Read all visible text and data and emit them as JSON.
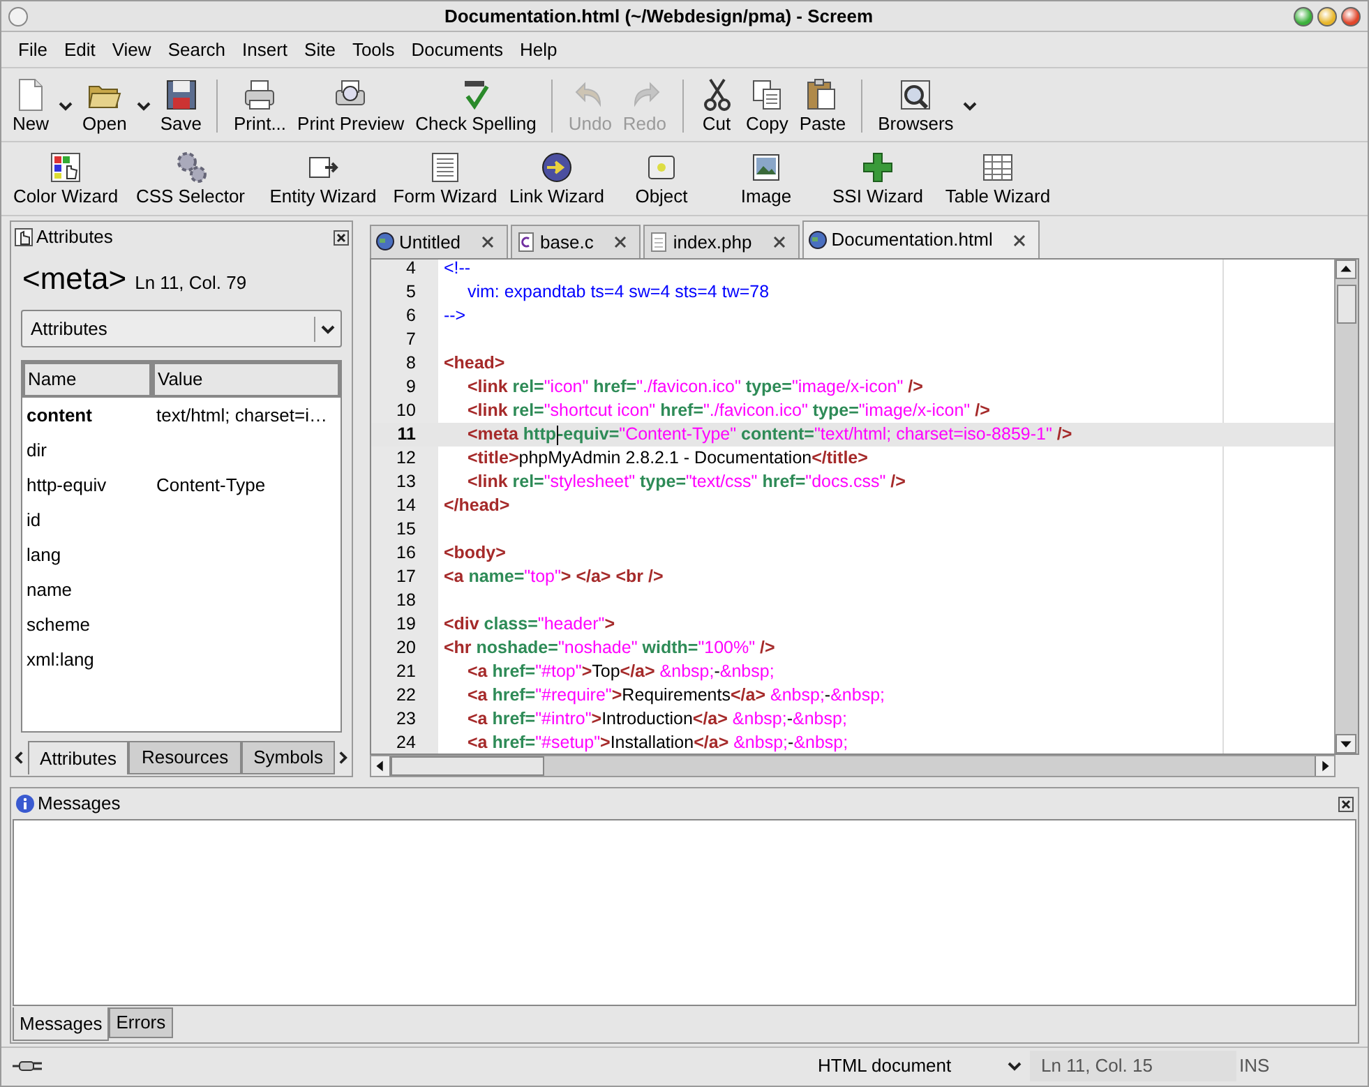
{
  "window": {
    "title": "Documentation.html (~/Webdesign/pma) - Screem"
  },
  "menu": [
    "File",
    "Edit",
    "View",
    "Search",
    "Insert",
    "Site",
    "Tools",
    "Documents",
    "Help"
  ],
  "toolbar": {
    "groups": [
      [
        {
          "label": "New",
          "menu": true,
          "disabled": false
        },
        {
          "label": "Open",
          "menu": true,
          "disabled": false
        },
        {
          "label": "Save",
          "menu": false,
          "disabled": false
        }
      ],
      [
        {
          "label": "Print...",
          "menu": false,
          "disabled": false
        },
        {
          "label": "Print Preview",
          "menu": false,
          "disabled": false
        },
        {
          "label": "Check Spelling",
          "menu": false,
          "disabled": false
        }
      ],
      [
        {
          "label": "Undo",
          "menu": false,
          "disabled": true
        },
        {
          "label": "Redo",
          "menu": false,
          "disabled": true
        }
      ],
      [
        {
          "label": "Cut",
          "menu": false,
          "disabled": false
        },
        {
          "label": "Copy",
          "menu": false,
          "disabled": false
        },
        {
          "label": "Paste",
          "menu": false,
          "disabled": false
        }
      ],
      [
        {
          "label": "Browsers",
          "menu": true,
          "disabled": false
        }
      ]
    ]
  },
  "wizards": [
    "Color Wizard",
    "CSS Selector",
    "Entity Wizard",
    "Form Wizard",
    "Link Wizard",
    "Object",
    "Image",
    "SSI Wizard",
    "Table Wizard"
  ],
  "attributes_panel": {
    "title": "Attributes",
    "tag": "<meta>",
    "position": "Ln 11, Col. 79",
    "view": "Attributes",
    "columns": [
      "Name",
      "Value"
    ],
    "rows": [
      {
        "name": "content",
        "value": "text/html; charset=i…",
        "selected": true
      },
      {
        "name": "dir",
        "selected": false
      },
      {
        "name": "http-equiv",
        "value": "Content-Type",
        "selected": false
      },
      {
        "name": "id",
        "selected": false
      },
      {
        "name": "lang",
        "selected": false
      },
      {
        "name": "name",
        "selected": false
      },
      {
        "name": "scheme",
        "selected": false
      },
      {
        "name": "xml:lang",
        "selected": false
      }
    ],
    "tabs": [
      {
        "label": "Attributes",
        "selected": true
      },
      {
        "label": "Resources",
        "selected": false
      },
      {
        "label": "Symbols",
        "selected": false
      }
    ]
  },
  "editor": {
    "tabs": [
      {
        "label": "Untitled",
        "selected": false
      },
      {
        "label": "base.c",
        "selected": false
      },
      {
        "label": "index.php",
        "selected": false
      },
      {
        "label": "Documentation.html",
        "selected": true
      }
    ],
    "lines": [
      {
        "number": "4",
        "indented": false,
        "current": false,
        "tokens": [
          {
            "kind": "comment",
            "text": "<!--"
          }
        ]
      },
      {
        "number": "5",
        "indented": true,
        "current": false,
        "tokens": [
          {
            "kind": "comment",
            "text": "vim: expandtab ts=4 sw=4 sts=4 tw=78"
          }
        ]
      },
      {
        "number": "6",
        "indented": false,
        "current": false,
        "tokens": [
          {
            "kind": "comment",
            "text": "-->"
          }
        ]
      },
      {
        "number": "7",
        "current": false
      },
      {
        "number": "8",
        "indented": false,
        "current": false,
        "tokens": [
          {
            "kind": "tag",
            "text": "<head>"
          }
        ]
      },
      {
        "number": "9",
        "indented": true,
        "current": false,
        "tokens": [
          {
            "kind": "tag",
            "text": "<link"
          },
          {
            "kind": "attr",
            "text": " rel="
          },
          {
            "kind": "value",
            "text": "\"icon\""
          },
          {
            "kind": "attr",
            "text": " href="
          },
          {
            "kind": "value",
            "text": "\"./favicon.ico\""
          },
          {
            "kind": "attr",
            "text": " type="
          },
          {
            "kind": "value",
            "text": "\"image/x-icon\""
          },
          {
            "kind": "tag",
            "text": " />"
          }
        ]
      },
      {
        "number": "10",
        "indented": true,
        "current": false,
        "tokens": [
          {
            "kind": "tag",
            "text": "<link"
          },
          {
            "kind": "attr",
            "text": " rel="
          },
          {
            "kind": "value",
            "text": "\"shortcut icon\""
          },
          {
            "kind": "attr",
            "text": " href="
          },
          {
            "kind": "value",
            "text": "\"./favicon.ico\""
          },
          {
            "kind": "attr",
            "text": " type="
          },
          {
            "kind": "value",
            "text": "\"image/x-icon\""
          },
          {
            "kind": "tag",
            "text": " />"
          }
        ]
      },
      {
        "number": "11",
        "indented": true,
        "current": true,
        "tokens": [
          {
            "kind": "tag",
            "text": "<meta"
          },
          {
            "kind": "attr",
            "text": " http"
          },
          {
            "kind": "cursor"
          },
          {
            "kind": "attr",
            "text": "-equiv="
          },
          {
            "kind": "value",
            "text": "\"Content-Type\""
          },
          {
            "kind": "attr",
            "text": " content="
          },
          {
            "kind": "value",
            "text": "\"text/html; charset=iso-8859-1\""
          },
          {
            "kind": "tag",
            "text": " />"
          }
        ]
      },
      {
        "number": "12",
        "indented": true,
        "current": false,
        "tokens": [
          {
            "kind": "tag",
            "text": "<title>"
          },
          {
            "kind": "text",
            "text": "phpMyAdmin 2.8.2.1 - Documentation"
          },
          {
            "kind": "tag",
            "text": "</title>"
          }
        ]
      },
      {
        "number": "13",
        "indented": true,
        "current": false,
        "tokens": [
          {
            "kind": "tag",
            "text": "<link"
          },
          {
            "kind": "attr",
            "text": " rel="
          },
          {
            "kind": "value",
            "text": "\"stylesheet\""
          },
          {
            "kind": "attr",
            "text": " type="
          },
          {
            "kind": "value",
            "text": "\"text/css\""
          },
          {
            "kind": "attr",
            "text": " href="
          },
          {
            "kind": "value",
            "text": "\"docs.css\""
          },
          {
            "kind": "tag",
            "text": " />"
          }
        ]
      },
      {
        "number": "14",
        "indented": false,
        "current": false,
        "tokens": [
          {
            "kind": "tag",
            "text": "</head>"
          }
        ]
      },
      {
        "number": "15",
        "current": false
      },
      {
        "number": "16",
        "indented": false,
        "current": false,
        "tokens": [
          {
            "kind": "tag",
            "text": "<body>"
          }
        ]
      },
      {
        "number": "17",
        "indented": false,
        "current": false,
        "tokens": [
          {
            "kind": "tag",
            "text": "<a"
          },
          {
            "kind": "attr",
            "text": " name="
          },
          {
            "kind": "value",
            "text": "\"top\""
          },
          {
            "kind": "tag",
            "text": "> </a> <br />"
          }
        ]
      },
      {
        "number": "18",
        "current": false
      },
      {
        "number": "19",
        "indented": false,
        "current": false,
        "tokens": [
          {
            "kind": "tag",
            "text": "<div"
          },
          {
            "kind": "attr",
            "text": " class="
          },
          {
            "kind": "value",
            "text": "\"header\""
          },
          {
            "kind": "tag",
            "text": ">"
          }
        ]
      },
      {
        "number": "20",
        "indented": false,
        "current": false,
        "tokens": [
          {
            "kind": "tag",
            "text": "<hr"
          },
          {
            "kind": "attr",
            "text": " noshade="
          },
          {
            "kind": "value",
            "text": "\"noshade\""
          },
          {
            "kind": "attr",
            "text": " width="
          },
          {
            "kind": "value",
            "text": "\"100%\""
          },
          {
            "kind": "tag",
            "text": " />"
          }
        ]
      },
      {
        "number": "21",
        "indented": true,
        "current": false,
        "tokens": [
          {
            "kind": "tag",
            "text": "<a"
          },
          {
            "kind": "attr",
            "text": " href="
          },
          {
            "kind": "value",
            "text": "\"#top\""
          },
          {
            "kind": "tag",
            "text": ">"
          },
          {
            "kind": "text",
            "text": "Top"
          },
          {
            "kind": "tag",
            "text": "</a>"
          },
          {
            "kind": "value",
            "text": " &nbsp;"
          },
          {
            "kind": "text",
            "text": "-"
          },
          {
            "kind": "value",
            "text": "&nbsp;"
          }
        ]
      },
      {
        "number": "22",
        "indented": true,
        "current": false,
        "tokens": [
          {
            "kind": "tag",
            "text": "<a"
          },
          {
            "kind": "attr",
            "text": " href="
          },
          {
            "kind": "value",
            "text": "\"#require\""
          },
          {
            "kind": "tag",
            "text": ">"
          },
          {
            "kind": "text",
            "text": "Requirements"
          },
          {
            "kind": "tag",
            "text": "</a>"
          },
          {
            "kind": "value",
            "text": " &nbsp;"
          },
          {
            "kind": "text",
            "text": "-"
          },
          {
            "kind": "value",
            "text": "&nbsp;"
          }
        ]
      },
      {
        "number": "23",
        "indented": true,
        "current": false,
        "tokens": [
          {
            "kind": "tag",
            "text": "<a"
          },
          {
            "kind": "attr",
            "text": " href="
          },
          {
            "kind": "value",
            "text": "\"#intro\""
          },
          {
            "kind": "tag",
            "text": ">"
          },
          {
            "kind": "text",
            "text": "Introduction"
          },
          {
            "kind": "tag",
            "text": "</a>"
          },
          {
            "kind": "value",
            "text": " &nbsp;"
          },
          {
            "kind": "text",
            "text": "-"
          },
          {
            "kind": "value",
            "text": "&nbsp;"
          }
        ]
      },
      {
        "number": "24",
        "indented": true,
        "current": false,
        "tokens": [
          {
            "kind": "tag",
            "text": "<a"
          },
          {
            "kind": "attr",
            "text": " href="
          },
          {
            "kind": "value",
            "text": "\"#setup\""
          },
          {
            "kind": "tag",
            "text": ">"
          },
          {
            "kind": "text",
            "text": "Installation"
          },
          {
            "kind": "tag",
            "text": "</a>"
          },
          {
            "kind": "value",
            "text": " &nbsp;"
          },
          {
            "kind": "text",
            "text": "-"
          },
          {
            "kind": "value",
            "text": "&nbsp;"
          }
        ]
      }
    ]
  },
  "messages_panel": {
    "title": "Messages",
    "tabs": [
      {
        "label": "Messages",
        "selected": true
      },
      {
        "label": "Errors",
        "selected": false
      }
    ]
  },
  "status_bar": {
    "doc_type": "HTML document",
    "position": "Ln 11, Col. 15",
    "mode": "INS"
  }
}
